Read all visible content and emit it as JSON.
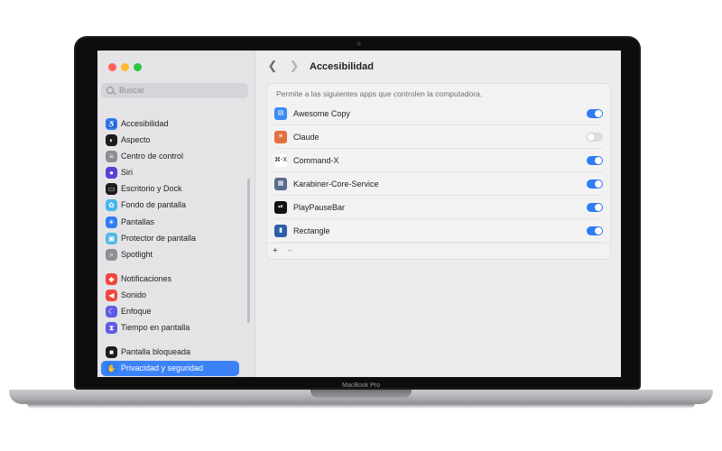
{
  "device": {
    "label": "MacBook Pro"
  },
  "sidebar": {
    "search_placeholder": "Buscar",
    "items": [
      {
        "label": "Accesibilidad",
        "icon": "accessibility-icon",
        "color": "#2f7cf6",
        "glyph": "♿"
      },
      {
        "label": "Aspecto",
        "icon": "appearance-icon",
        "color": "#1c1c1e",
        "glyph": "◐"
      },
      {
        "label": "Centro de control",
        "icon": "control-center-icon",
        "color": "#8e8e93",
        "glyph": "≡"
      },
      {
        "label": "Siri",
        "icon": "siri-icon",
        "color": "#5b3fd6",
        "glyph": "●"
      },
      {
        "label": "Escritorio y Dock",
        "icon": "desktop-dock-icon",
        "color": "#1c1c1e",
        "glyph": "▭"
      },
      {
        "label": "Fondo de pantalla",
        "icon": "wallpaper-icon",
        "color": "#45b6f0",
        "glyph": "✿"
      },
      {
        "label": "Pantallas",
        "icon": "displays-icon",
        "color": "#2f7cf6",
        "glyph": "☀"
      },
      {
        "label": "Protector de pantalla",
        "icon": "screensaver-icon",
        "color": "#4fb8e8",
        "glyph": "▣"
      },
      {
        "label": "Spotlight",
        "icon": "spotlight-icon",
        "color": "#8e8e93",
        "glyph": "⌕"
      },
      {
        "label": "Notificaciones",
        "icon": "notifications-icon",
        "color": "#f2453d",
        "glyph": "◆"
      },
      {
        "label": "Sonido",
        "icon": "sound-icon",
        "color": "#f2453d",
        "glyph": "◀"
      },
      {
        "label": "Enfoque",
        "icon": "focus-icon",
        "color": "#5e5ce6",
        "glyph": "☾"
      },
      {
        "label": "Tiempo en pantalla",
        "icon": "screen-time-icon",
        "color": "#5e5ce6",
        "glyph": "⧗"
      },
      {
        "label": "Pantalla bloqueada",
        "icon": "lock-screen-icon",
        "color": "#1c1c1e",
        "glyph": "■"
      },
      {
        "label": "Privacidad y seguridad",
        "icon": "privacy-hand-icon",
        "color": "#2f7cf6",
        "glyph": "✋",
        "active": true
      }
    ]
  },
  "main": {
    "title": "Accesibilidad",
    "description": "Permite a las siguientes apps que controlen la computadora.",
    "apps": [
      {
        "name": "Awesome Copy",
        "icon": "awesome-copy-icon",
        "color": "#3d8bf2",
        "glyph": "▤",
        "enabled": true
      },
      {
        "name": "Claude",
        "icon": "claude-icon",
        "color": "#e0703f",
        "glyph": "✳",
        "enabled": false
      },
      {
        "name": "Command-X",
        "icon": "command-x-icon",
        "color": "#ffffff",
        "glyph": "⌘-X",
        "glyph_color": "#222222",
        "enabled": true
      },
      {
        "name": "Karabiner-Core-Service",
        "icon": "karabiner-icon",
        "color": "#5a6b8c",
        "glyph": "▦",
        "enabled": true
      },
      {
        "name": "PlayPauseBar",
        "icon": "play-pause-icon",
        "color": "#111111",
        "glyph": "⏯",
        "enabled": true
      },
      {
        "name": "Rectangle",
        "icon": "rectangle-icon",
        "color": "#2d5fa8",
        "glyph": "▮",
        "enabled": true
      }
    ],
    "add_label": "+",
    "remove_label": "−"
  },
  "colors": {
    "accent": "#2f7cf6",
    "toggle_off": "#dcdcdf"
  }
}
